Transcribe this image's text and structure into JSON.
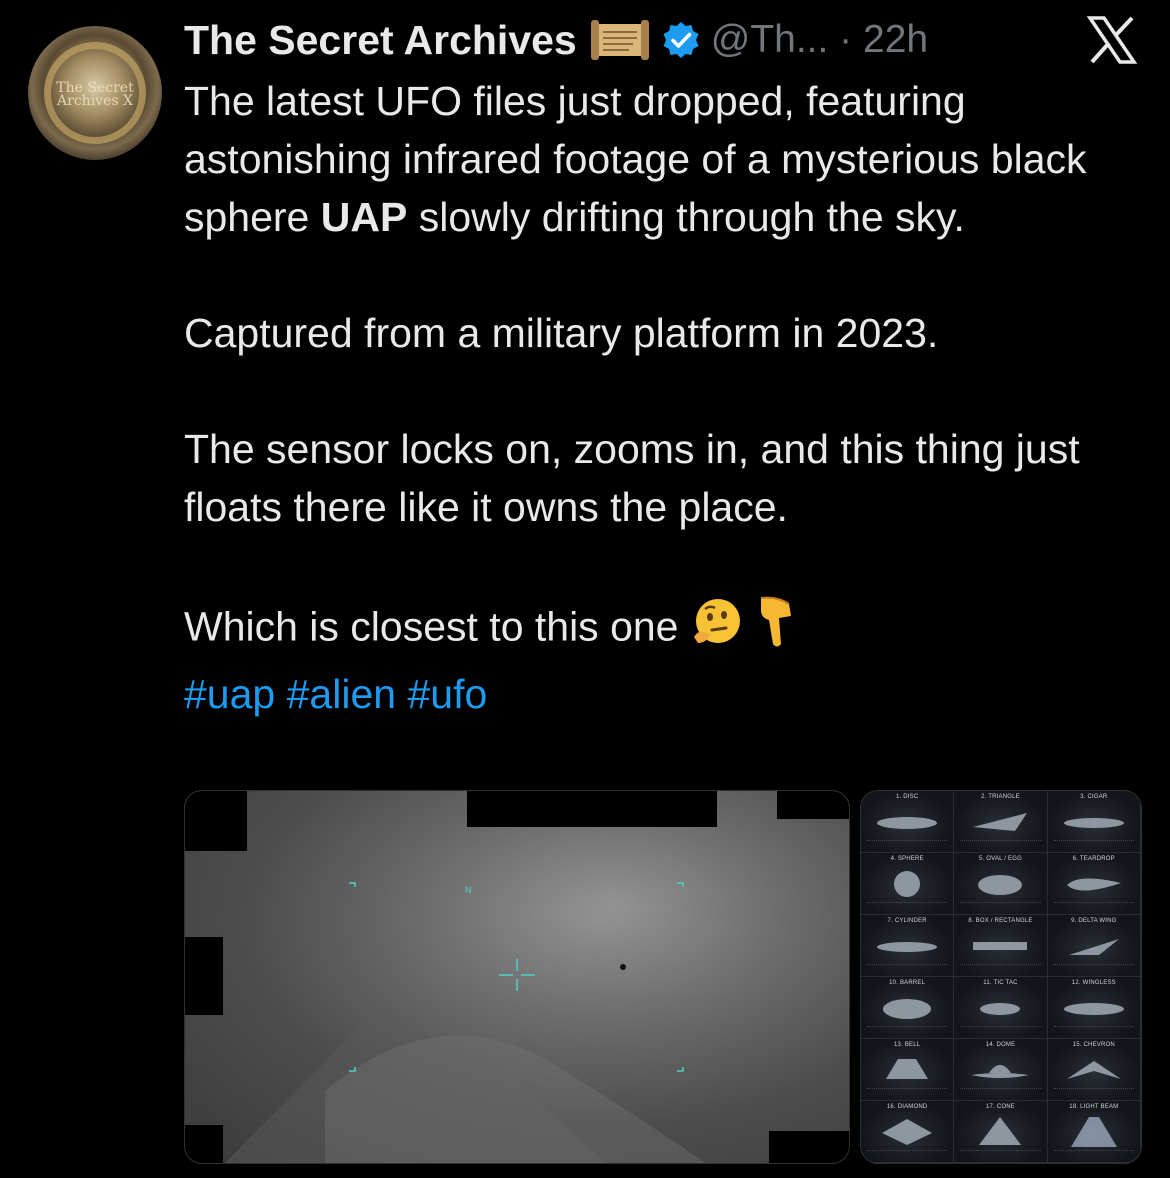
{
  "tweet": {
    "author_name": "The Secret Archives",
    "handle_time": "@Th... · 22h",
    "avatar_text": "The Secret Archives X",
    "text_line1_a": "The latest UFO files just dropped, featuring astonishing infrared footage of a mysterious black sphere ",
    "text_line1_bold": "UAP",
    "text_line1_b": " slowly drifting through the sky.",
    "text_para2": "Captured from a military platform in 2023.",
    "text_para3": "The sensor locks on, zooms in, and this thing just floats there like it owns the place.",
    "text_para4": "Which is closest to this one",
    "hashtags": [
      "#uap",
      "#alien",
      "#ufo"
    ]
  },
  "media": {
    "overlay_marker": "N",
    "chart_labels": [
      "1. DISC",
      "2. TRIANGLE",
      "3. CIGAR",
      "4. SPHERE",
      "5. OVAL / EGG",
      "6. TEARDROP",
      "7. CYLINDER",
      "8. BOX / RECTANGLE",
      "9. DELTA WING",
      "10. BARREL",
      "11. TIC TAC",
      "12. WINGLESS",
      "13. BELL",
      "14. DOME",
      "15. CHEVRON",
      "16. DIAMOND",
      "17. CONE",
      "18. LIGHT BEAM"
    ]
  },
  "colors": {
    "hashtag": "#1d9bf0",
    "verified": "#1d9bf0",
    "text": "#e7e9ea",
    "muted": "#71767b"
  },
  "icons": [
    "scroll-emoji",
    "verified-badge-icon",
    "x-logo-icon",
    "thinking-face-emoji",
    "pointing-down-emoji"
  ]
}
